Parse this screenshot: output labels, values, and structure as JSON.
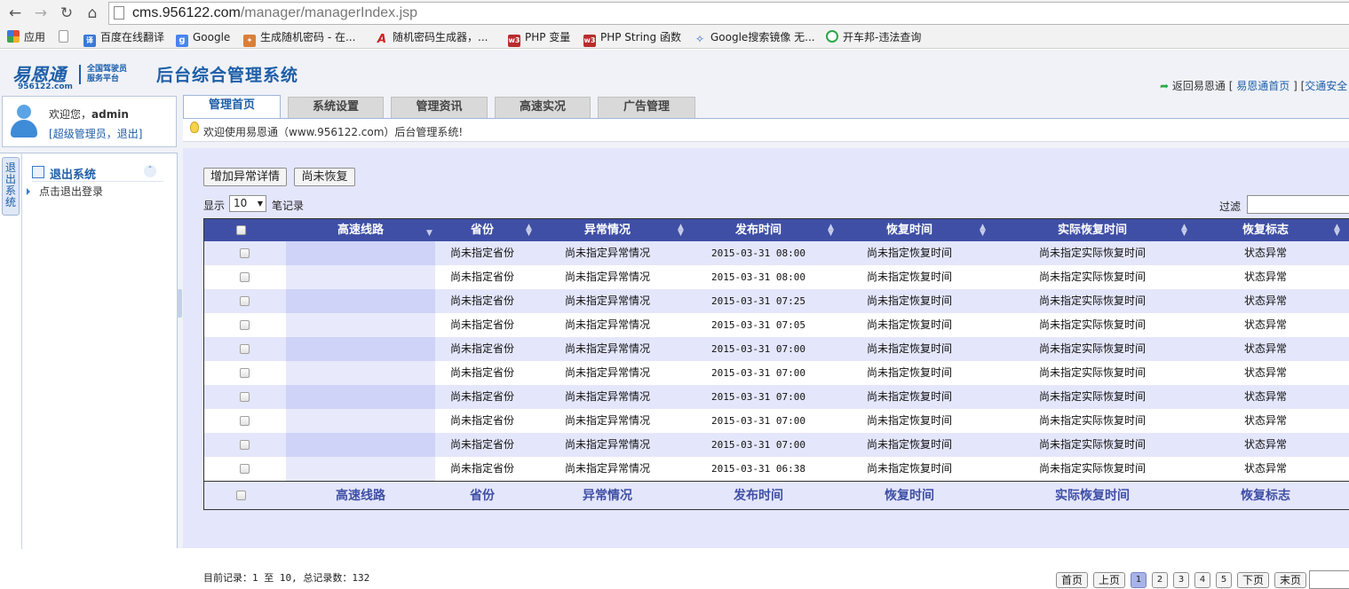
{
  "browser": {
    "url_host": "cms.956122.com",
    "url_path": "/manager/managerIndex.jsp",
    "bookmarks": [
      {
        "label": "应用",
        "icon": "apps-grid-icon",
        "color": "#e04a3a"
      },
      {
        "label": "",
        "icon": "blank-page-icon",
        "color": "#ffffff"
      },
      {
        "label": "百度在线翻译",
        "icon": "baidu-translate-icon",
        "color": "#3a79d8"
      },
      {
        "label": "Google",
        "icon": "google-icon",
        "color": "#4a84f0"
      },
      {
        "label": "生成随机密码 - 在...",
        "icon": "tool-icon",
        "color": "#d8803a"
      },
      {
        "label": "随机密码生成器，...",
        "icon": "letter-a-icon",
        "color": "#d02020"
      },
      {
        "label": "PHP 变量",
        "icon": "w3-icon",
        "color": "#b92c2c"
      },
      {
        "label": "PHP String 函数",
        "icon": "w3-icon",
        "color": "#b92c2c"
      },
      {
        "label": "Google搜索镜像 无...",
        "icon": "mirror-bird-icon",
        "color": "#2a64c8"
      },
      {
        "label": "开车邦-违法查询",
        "icon": "steering-wheel-icon",
        "color": "#2aa84a"
      }
    ]
  },
  "header": {
    "logo_brand": "易恩通",
    "logo_domain": "956122.com",
    "logo_slogan_1": "全国驾驶员",
    "logo_slogan_2": "服务平台",
    "system_title": "后台综合管理系统",
    "links": {
      "back": "返回易恩通",
      "home": "易恩通首页",
      "traffic": "交通安全"
    }
  },
  "user": {
    "welcome_prefix": "欢迎您，",
    "username": "admin",
    "role": "超级管理员",
    "logout": "退出"
  },
  "sidebar": {
    "vertical_tab": "退出系统",
    "menu_title": "退出系统",
    "menu_item": "点击退出登录"
  },
  "tabs": [
    "管理首页",
    "系统设置",
    "管理资讯",
    "高速实况",
    "广告管理"
  ],
  "notice": "欢迎使用易恩通（www.956122.com）后台管理系统!",
  "actions": {
    "add": "增加异常详情",
    "unrecovered": "尚未恢复"
  },
  "length_menu": {
    "show": "显示",
    "value": "10",
    "records": "笔记录"
  },
  "filter_label": "过滤",
  "table": {
    "columns": [
      "高速线路",
      "省份",
      "异常情况",
      "发布时间",
      "恢复时间",
      "实际恢复时间",
      "恢复标志"
    ],
    "rows": [
      {
        "route": "",
        "province": "尚未指定省份",
        "issue": "尚未指定异常情况",
        "published": "2015-03-31 08:00",
        "recovery": "尚未指定恢复时间",
        "actual": "尚未指定实际恢复时间",
        "flag": "状态异常"
      },
      {
        "route": "",
        "province": "尚未指定省份",
        "issue": "尚未指定异常情况",
        "published": "2015-03-31 08:00",
        "recovery": "尚未指定恢复时间",
        "actual": "尚未指定实际恢复时间",
        "flag": "状态异常"
      },
      {
        "route": "",
        "province": "尚未指定省份",
        "issue": "尚未指定异常情况",
        "published": "2015-03-31 07:25",
        "recovery": "尚未指定恢复时间",
        "actual": "尚未指定实际恢复时间",
        "flag": "状态异常"
      },
      {
        "route": "",
        "province": "尚未指定省份",
        "issue": "尚未指定异常情况",
        "published": "2015-03-31 07:05",
        "recovery": "尚未指定恢复时间",
        "actual": "尚未指定实际恢复时间",
        "flag": "状态异常"
      },
      {
        "route": "",
        "province": "尚未指定省份",
        "issue": "尚未指定异常情况",
        "published": "2015-03-31 07:00",
        "recovery": "尚未指定恢复时间",
        "actual": "尚未指定实际恢复时间",
        "flag": "状态异常"
      },
      {
        "route": "",
        "province": "尚未指定省份",
        "issue": "尚未指定异常情况",
        "published": "2015-03-31 07:00",
        "recovery": "尚未指定恢复时间",
        "actual": "尚未指定实际恢复时间",
        "flag": "状态异常"
      },
      {
        "route": "",
        "province": "尚未指定省份",
        "issue": "尚未指定异常情况",
        "published": "2015-03-31 07:00",
        "recovery": "尚未指定恢复时间",
        "actual": "尚未指定实际恢复时间",
        "flag": "状态异常"
      },
      {
        "route": "",
        "province": "尚未指定省份",
        "issue": "尚未指定异常情况",
        "published": "2015-03-31 07:00",
        "recovery": "尚未指定恢复时间",
        "actual": "尚未指定实际恢复时间",
        "flag": "状态异常"
      },
      {
        "route": "",
        "province": "尚未指定省份",
        "issue": "尚未指定异常情况",
        "published": "2015-03-31 07:00",
        "recovery": "尚未指定恢复时间",
        "actual": "尚未指定实际恢复时间",
        "flag": "状态异常"
      },
      {
        "route": "",
        "province": "尚未指定省份",
        "issue": "尚未指定异常情况",
        "published": "2015-03-31 06:38",
        "recovery": "尚未指定恢复时间",
        "actual": "尚未指定实际恢复时间",
        "flag": "状态异常"
      }
    ]
  },
  "info": "目前记录：1 至 10, 总记录数：132",
  "pagination": {
    "first": "首页",
    "prev": "上页",
    "pages": [
      "1",
      "2",
      "3",
      "4",
      "5"
    ],
    "current": "1",
    "next": "下页",
    "last": "末页"
  },
  "colors": {
    "header_bg": "#3f4fa5",
    "accent": "#1d5ea8",
    "content_bg": "#e4e6fb",
    "page_bg": "#f0f2f7"
  }
}
